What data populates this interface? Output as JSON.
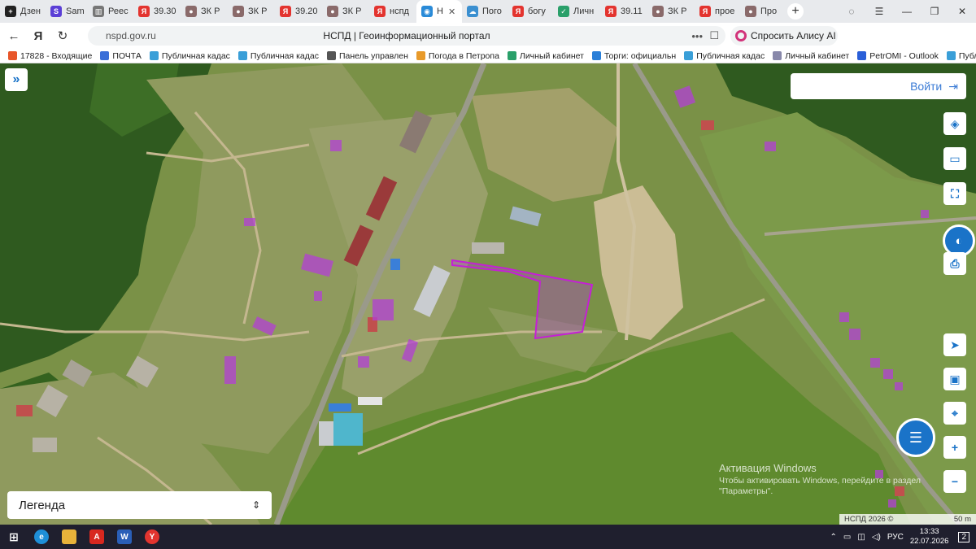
{
  "tabs": [
    {
      "label": "Дзен",
      "color": "#222"
    },
    {
      "label": "Sam",
      "color": "#5b3fd6"
    },
    {
      "label": "Реес",
      "color": "#777"
    },
    {
      "label": "39.30",
      "color": "#e3342f"
    },
    {
      "label": "ЗК Р",
      "color": "#8a6a6a"
    },
    {
      "label": "ЗК Р",
      "color": "#8a6a6a"
    },
    {
      "label": "39.20",
      "color": "#e3342f"
    },
    {
      "label": "ЗК Р",
      "color": "#8a6a6a"
    },
    {
      "label": "нспд",
      "color": "#e3342f"
    },
    {
      "label": "Н",
      "color": "#2a8bd8"
    },
    {
      "label": "Пого",
      "color": "#3a8fd0"
    },
    {
      "label": "богу",
      "color": "#e3342f"
    },
    {
      "label": "Личн",
      "color": "#2aa06a"
    },
    {
      "label": "39.11",
      "color": "#e3342f"
    },
    {
      "label": "ЗК Р",
      "color": "#8a6a6a"
    },
    {
      "label": "прое",
      "color": "#e3342f"
    },
    {
      "label": "Про",
      "color": "#8a6a6a"
    }
  ],
  "address": {
    "site": "nspd.gov.ru",
    "title": "НСПД | Геоинформационный портал",
    "alice": "Спросить Алису AI"
  },
  "bookmarks": [
    {
      "label": "17828 - Входящие",
      "color": "#e8562a"
    },
    {
      "label": "ПОЧТА",
      "color": "#3a6fd8"
    },
    {
      "label": "Публичная кадас",
      "color": "#3a9fd8"
    },
    {
      "label": "Публичная кадас",
      "color": "#3a9fd8"
    },
    {
      "label": "Панель управлен",
      "color": "#555"
    },
    {
      "label": "Погода в Петропа",
      "color": "#e89a2a"
    },
    {
      "label": "Личный кабинет",
      "color": "#2aa06a"
    },
    {
      "label": "Торги: официальн",
      "color": "#2a7fd8"
    },
    {
      "label": "Публичная кадас",
      "color": "#3a9fd8"
    },
    {
      "label": "Личный кабинет",
      "color": "#8888aa"
    },
    {
      "label": "PetrOMI - Outlook",
      "color": "#2a5fd8"
    },
    {
      "label": "Публичная ка",
      "color": "#3a9fd8"
    }
  ],
  "map": {
    "login_label": "Войти",
    "legend_label": "Легенда",
    "activation_title": "Активация Windows",
    "activation_text": "Чтобы активировать Windows, перейдите в раздел \"Параметры\".",
    "attribution": "НСПД 2026 ©",
    "scale": "50 m"
  },
  "taskbar": {
    "lang": "РУС",
    "time": "13:33",
    "date": "22.07.2026",
    "notif": "2"
  }
}
